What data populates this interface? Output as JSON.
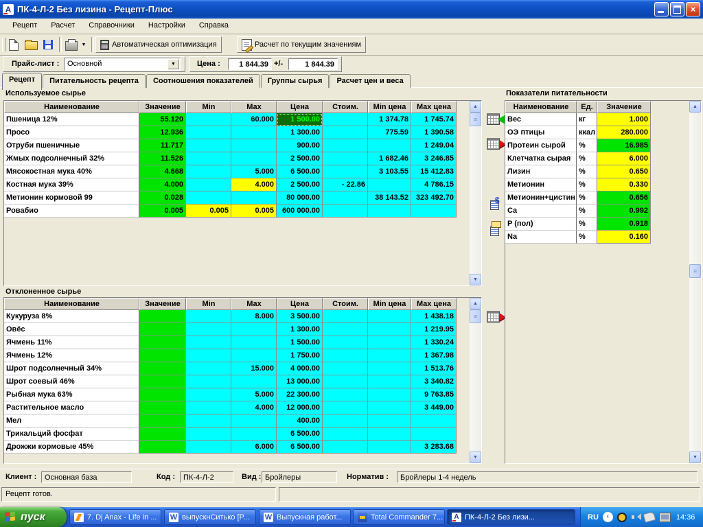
{
  "window": {
    "title": "ПК-4-Л-2 Без лизина - Рецепт-Плюс"
  },
  "menu": {
    "items": [
      "Рецепт",
      "Расчет",
      "Справочники",
      "Настройки",
      "Справка"
    ]
  },
  "toolbar": {
    "auto_optimize": "Автоматическая оптимизация",
    "calc_current": "Расчет по текущим значениям"
  },
  "pricebar": {
    "pricelist_label": "Прайс-лист :",
    "pricelist_value": "Основной",
    "price_label": "Цена :",
    "price_min": "1 844.39",
    "plus_minus": "+/-",
    "price_max": "1 844.39"
  },
  "tabs": {
    "active": 0,
    "items": [
      "Рецепт",
      "Питательность рецепта",
      "Соотношения показателей",
      "Группы сырья",
      "Расчет цен и веса"
    ]
  },
  "grid_headers": [
    "Наименование",
    "Значение",
    "Min",
    "Max",
    "Цена",
    "Стоим.",
    "Min цена",
    "Max цена"
  ],
  "used_materials": {
    "title": "Используемое сырье",
    "rows": [
      {
        "name": "Пшеница 12%",
        "value": "55.120",
        "min": "",
        "max": "60.000",
        "price": "1 500.00",
        "cost": "",
        "min_price": "1 374.78",
        "max_price": "1 745.74",
        "price_selected": true
      },
      {
        "name": "Просо",
        "value": "12.936",
        "min": "",
        "max": "",
        "price": "1 300.00",
        "cost": "",
        "min_price": "775.59",
        "max_price": "1 390.58"
      },
      {
        "name": "Отруби пшеничные",
        "value": "11.717",
        "min": "",
        "max": "",
        "price": "900.00",
        "cost": "",
        "min_price": "",
        "max_price": "1 249.04"
      },
      {
        "name": "Жмых подсолнечный 32%",
        "value": "11.526",
        "min": "",
        "max": "",
        "price": "2 500.00",
        "cost": "",
        "min_price": "1 682.46",
        "max_price": "3 246.85"
      },
      {
        "name": "Мясокостная мука 40%",
        "value": "4.668",
        "min": "",
        "max": "5.000",
        "price": "6 500.00",
        "cost": "",
        "min_price": "3 103.55",
        "max_price": "15 412.83"
      },
      {
        "name": "Костная мука 39%",
        "value": "4.000",
        "min": "",
        "max": "4.000",
        "max_hl": true,
        "price": "2 500.00",
        "cost": "- 22.86",
        "min_price": "",
        "max_price": "4 786.15"
      },
      {
        "name": "Метионин кормовой 99",
        "value": "0.028",
        "min": "",
        "max": "",
        "price": "80 000.00",
        "cost": "",
        "min_price": "38 143.52",
        "max_price": "323 492.70"
      },
      {
        "name": "Ровабио",
        "value": "0.005",
        "min": "0.005",
        "min_hl": true,
        "max": "0.005",
        "max_hl": true,
        "price": "600 000.00",
        "cost": "",
        "min_price": "",
        "max_price": ""
      }
    ]
  },
  "rejected_materials": {
    "title": "Отклоненное сырье",
    "rows": [
      {
        "name": "Кукуруза 8%",
        "value": "",
        "min": "",
        "max": "8.000",
        "price": "3 500.00",
        "cost": "",
        "min_price": "",
        "max_price": "1 438.18"
      },
      {
        "name": "Овёс",
        "value": "",
        "min": "",
        "max": "",
        "price": "1 300.00",
        "cost": "",
        "min_price": "",
        "max_price": "1 219.95"
      },
      {
        "name": "Ячмень 11%",
        "value": "",
        "min": "",
        "max": "",
        "price": "1 500.00",
        "cost": "",
        "min_price": "",
        "max_price": "1 330.24"
      },
      {
        "name": "Ячмень 12%",
        "value": "",
        "min": "",
        "max": "",
        "price": "1 750.00",
        "cost": "",
        "min_price": "",
        "max_price": "1 367.98"
      },
      {
        "name": "Шрот подсолнечный 34%",
        "value": "",
        "min": "",
        "max": "15.000",
        "price": "4 000.00",
        "cost": "",
        "min_price": "",
        "max_price": "1 513.76"
      },
      {
        "name": "Шрот соевый 46%",
        "value": "",
        "min": "",
        "max": "",
        "price": "13 000.00",
        "cost": "",
        "min_price": "",
        "max_price": "3 340.82"
      },
      {
        "name": "Рыбная мука 63%",
        "value": "",
        "min": "",
        "max": "5.000",
        "price": "22 300.00",
        "cost": "",
        "min_price": "",
        "max_price": "9 763.85"
      },
      {
        "name": "Растительное масло",
        "value": "",
        "min": "",
        "max": "4.000",
        "price": "12 000.00",
        "cost": "",
        "min_price": "",
        "max_price": "3 449.00"
      },
      {
        "name": "Мел",
        "value": "",
        "min": "",
        "max": "",
        "price": "400.00",
        "cost": "",
        "min_price": "",
        "max_price": ""
      },
      {
        "name": "Трикальций фосфат",
        "value": "",
        "min": "",
        "max": "",
        "price": "6 500.00",
        "cost": "",
        "min_price": "",
        "max_price": ""
      },
      {
        "name": "Дрожжи кормовые 45%",
        "value": "",
        "min": "",
        "max": "6.000",
        "price": "6 500.00",
        "cost": "",
        "min_price": "",
        "max_price": "3 283.68"
      }
    ]
  },
  "nutrition": {
    "title": "Показатели питательности",
    "headers": [
      "Наименование",
      "Ед.",
      "Значение"
    ],
    "rows": [
      {
        "name": "Вес",
        "unit": "кг",
        "value": "1.000",
        "color": "yellow"
      },
      {
        "name": "ОЭ птицы",
        "unit": "ккал",
        "value": "280.000",
        "color": "yellow"
      },
      {
        "name": "Протеин сырой",
        "unit": "%",
        "value": "16.985",
        "color": "green"
      },
      {
        "name": "Клетчатка сырая",
        "unit": "%",
        "value": "6.000",
        "color": "yellow"
      },
      {
        "name": "Лизин",
        "unit": "%",
        "value": "0.650",
        "color": "yellow"
      },
      {
        "name": "Метионин",
        "unit": "%",
        "value": "0.330",
        "color": "yellow"
      },
      {
        "name": "Метионин+цистин",
        "unit": "%",
        "value": "0.656",
        "color": "green"
      },
      {
        "name": "Ca",
        "unit": "%",
        "value": "0.992",
        "color": "green"
      },
      {
        "name": "P (пол)",
        "unit": "%",
        "value": "0.918",
        "color": "green"
      },
      {
        "name": "Na",
        "unit": "%",
        "value": "0.160",
        "color": "yellow"
      }
    ]
  },
  "footer": {
    "client_label": "Клиент :",
    "client": "Основная база",
    "code_label": "Код :",
    "code": "ПК-4-Л-2",
    "kind_label": "Вид :",
    "kind": "Бройлеры",
    "norm_label": "Норматив :",
    "norm": "Бройлеры 1-4 недель"
  },
  "statusbar": {
    "text": "Рецепт готов."
  },
  "taskbar": {
    "start": "пуск",
    "tasks": [
      {
        "label": "7. Dj Anax - Life in ...",
        "icon": "winamp",
        "active": false
      },
      {
        "label": "выпускнСитько [P...",
        "icon": "word",
        "active": false
      },
      {
        "label": "Выпускная работ...",
        "icon": "word",
        "active": false
      },
      {
        "label": "Total Commander 7...",
        "icon": "totalcmd",
        "active": false
      },
      {
        "label": "ПК-4-Л-2 Без лизи...",
        "icon": "recept",
        "active": true
      }
    ],
    "tray": {
      "lang": "RU",
      "time": "14:36"
    }
  },
  "colors": {
    "cell_green": "#00e400",
    "cell_cyan": "#00ffff",
    "cell_yellow": "#ffff00",
    "selected_cell_bg": "#0b6e0b",
    "selected_cell_fg": "#00ff00",
    "panel": "#ece9d8",
    "titlebar": "#0d4fc4"
  }
}
